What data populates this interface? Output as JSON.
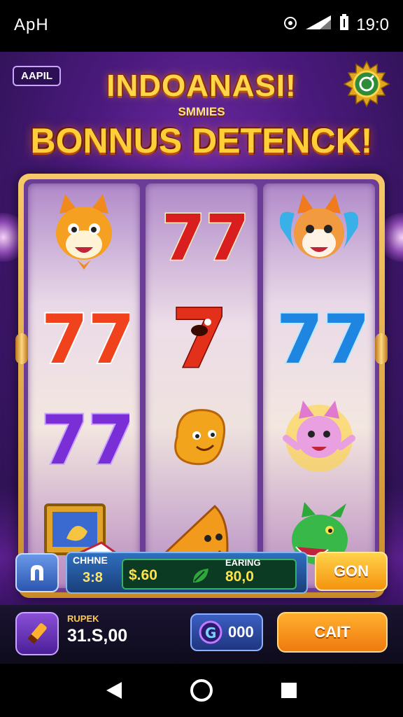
{
  "status_bar": {
    "carrier": "ApH",
    "time": "19:0"
  },
  "header": {
    "badge": "AAPIL",
    "title": "INDOANASI!",
    "subtitle": "SMMIES",
    "bonus_text": "BONNUS DETENCK!"
  },
  "reels": [
    [
      "fox-cat-icon",
      "sevens-red-orange-icon",
      "sevens-purple-icon",
      "treasure-chest-icon"
    ],
    [
      "sevens-red-icon",
      "seven-monster-icon",
      "golden-blob-icon",
      "orange-cone-icon"
    ],
    [
      "fox-mask-icon",
      "sevens-blue-icon",
      "pink-cat-icon",
      "green-dragon-icon"
    ]
  ],
  "controls": {
    "credits_label": "CHHNE",
    "credits_value": "3:8",
    "cash_value": "$.60",
    "earning_label": "EARING",
    "earning_value": "80,0",
    "go_label": "GON"
  },
  "bottom_bar": {
    "balance_label": "RUPEK",
    "balance_value": "31.S,00",
    "coins_value": "000",
    "cart_label": "CAIT"
  },
  "colors": {
    "background": "#4b1a7e",
    "gold": "#ffd54a",
    "accent_orange": "#f5930e",
    "accent_blue": "#2b56b0"
  }
}
